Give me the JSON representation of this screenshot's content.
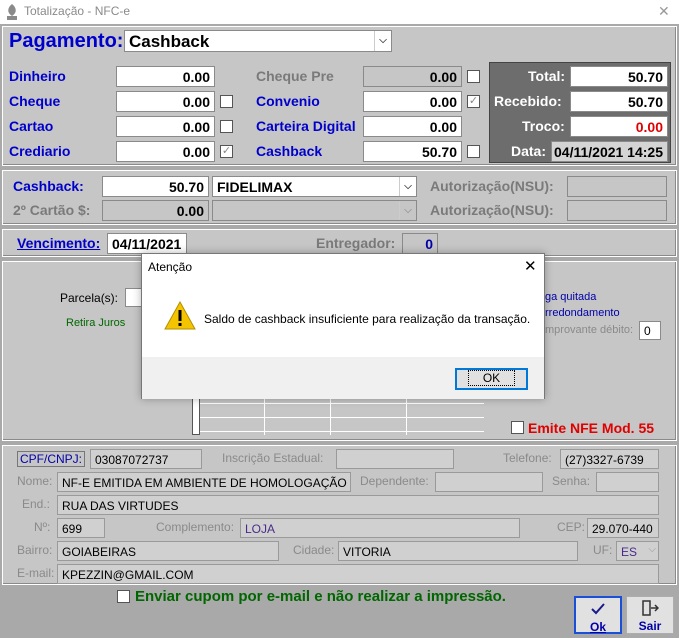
{
  "window": {
    "title": "Totalização - NFC-e",
    "close_glyph": "✕",
    "app_icon": "leaf-app-icon"
  },
  "payment": {
    "label": "Pagamento:",
    "method": "Cashback",
    "rows_left": [
      {
        "label": "Dinheiro",
        "value": "0.00",
        "checked": false,
        "show_chk": false
      },
      {
        "label": "Cheque",
        "value": "0.00",
        "checked": false,
        "show_chk": true
      },
      {
        "label": "Cartao",
        "value": "0.00",
        "checked": false,
        "show_chk": true
      },
      {
        "label": "Crediario",
        "value": "0.00",
        "checked": true,
        "show_chk": true
      }
    ],
    "rows_mid": [
      {
        "label": "Cheque Pre",
        "value": "0.00",
        "disabled": true
      },
      {
        "label": "Convenio",
        "value": "0.00"
      },
      {
        "label": "Carteira Digital",
        "value": "0.00"
      },
      {
        "label": "Cashback",
        "value": "50.70"
      }
    ],
    "summary": {
      "total_label": "Total:",
      "total": "50.70",
      "received_label": "Recebido:",
      "received": "50.70",
      "change_label": "Troco:",
      "change": "0.00",
      "date_label": "Data:",
      "date": "04/11/2021 14:25"
    }
  },
  "cashback": {
    "label": "Cashback:",
    "value": "50.70",
    "provider": "FIDELIMAX",
    "auth_label": "Autorização(NSU):",
    "card2_label": "2º Cartão $:",
    "card2_value": "0.00",
    "auth2_label": "Autorização(NSU):"
  },
  "due": {
    "label": "Vencimento:",
    "value": "04/11/2021",
    "deliverer_label": "Entregador:",
    "deliverer_value": "0"
  },
  "installments": {
    "parcel_label": "Parcela(s):",
    "interest_label": "Retira Juros",
    "paid_label": "ga quitada",
    "rounding_label": "rredondamento",
    "receipt_label": "mprovante débito:",
    "receipt_value": "0",
    "nfe_label": "Emite NFE Mod. 55"
  },
  "customer": {
    "cpf_label": "CPF/CNPJ:",
    "cpf": "03087072737",
    "ie_label": "Inscrição Estadual:",
    "ie": "",
    "phone_label": "Telefone:",
    "phone": "(27)3327-6739",
    "name_label": "Nome:",
    "name": "NF-E EMITIDA EM AMBIENTE DE HOMOLOGAÇÃO",
    "dependent_label": "Dependente:",
    "dependent": "",
    "password_label": "Senha:",
    "password": "",
    "address_label": "End.:",
    "address": "RUA DAS VIRTUDES",
    "number_label": "Nº:",
    "number": "699",
    "complement_label": "Complemento:",
    "complement": "LOJA",
    "cep_label": "CEP:",
    "cep": "29.070-440",
    "district_label": "Bairro:",
    "district": "GOIABEIRAS",
    "city_label": "Cidade:",
    "city": "VITORIA",
    "uf_label": "UF:",
    "uf": "ES",
    "email_label": "E-mail:",
    "email": "KPEZZIN@GMAIL.COM"
  },
  "footer": {
    "email_option": "Enviar cupom por e-mail e não realizar a impressão.",
    "ok_label": "Ok",
    "exit_label": "Sair"
  },
  "dialog": {
    "title": "Atenção",
    "message": "Saldo de cashback insuficiente para realização da transação.",
    "ok_label": "OK",
    "icon": "warning-icon"
  }
}
